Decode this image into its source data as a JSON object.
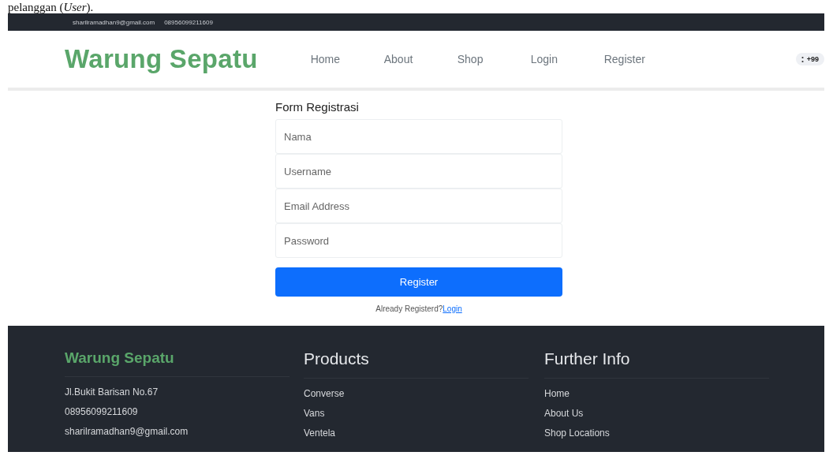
{
  "document_caption": "pelanggan (*User*).",
  "topbar": {
    "email": "sharilramadhan9@gmail.com",
    "phone": "08956099211609"
  },
  "header": {
    "brand": "Warung Sepatu",
    "nav": [
      {
        "label": "Home",
        "selected": false
      },
      {
        "label": "About",
        "selected": false
      },
      {
        "label": "Shop",
        "selected": false
      },
      {
        "label": "Login",
        "selected": false
      },
      {
        "label": "Register",
        "selected": false
      }
    ],
    "cart_badge": "+99"
  },
  "form": {
    "title": "Form Registrasi",
    "fields": [
      {
        "placeholder": "Nama"
      },
      {
        "placeholder": "Username"
      },
      {
        "placeholder": "Email Address"
      },
      {
        "placeholder": "Password"
      }
    ],
    "submit": "Register",
    "prompt": "Already Registerd?",
    "link": "Login"
  },
  "footer": {
    "columns": [
      {
        "title": "Warung Sepatu",
        "kind": "brand",
        "items": [
          "Jl.Bukit Barisan No.67",
          "08956099211609",
          "sharilramadhan9@gmail.com"
        ]
      },
      {
        "title": "Products",
        "kind": "links",
        "items": [
          "Converse",
          "Vans",
          "Ventela"
        ]
      },
      {
        "title": "Further Info",
        "kind": "links",
        "items": [
          "Home",
          "About Us",
          "Shop Locations"
        ]
      }
    ]
  }
}
